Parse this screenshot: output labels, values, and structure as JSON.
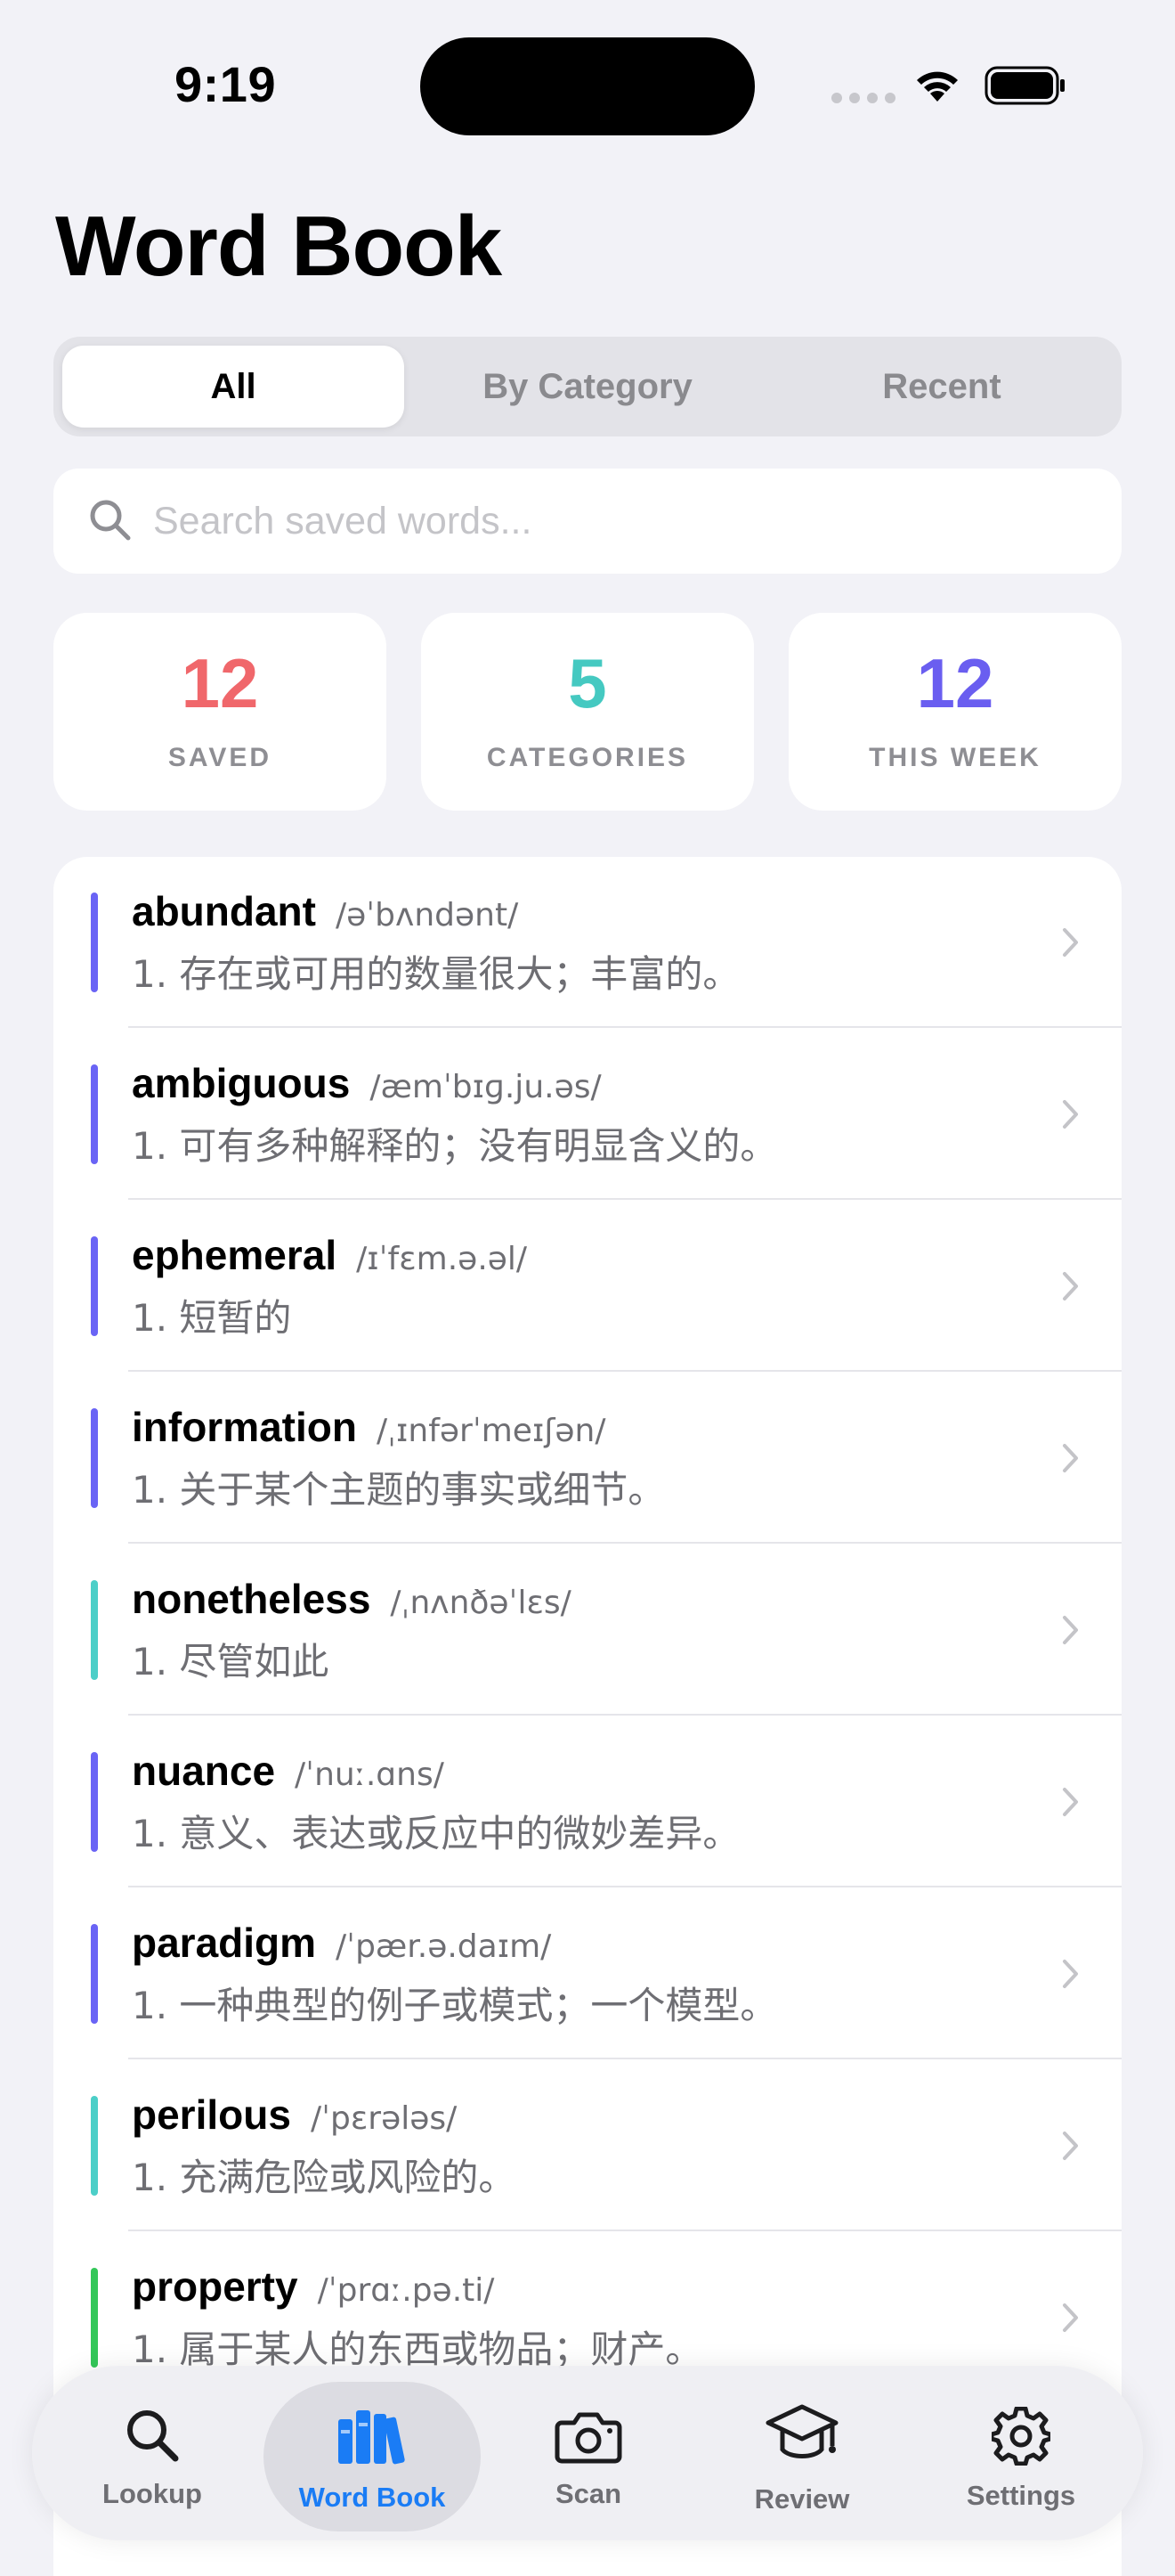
{
  "status_bar": {
    "time": "9:19"
  },
  "header": {
    "title": "Word Book"
  },
  "segments": [
    {
      "label": "All",
      "active": true
    },
    {
      "label": "By Category",
      "active": false
    },
    {
      "label": "Recent",
      "active": false
    }
  ],
  "search": {
    "placeholder": "Search saved words...",
    "value": ""
  },
  "stats": [
    {
      "value": "12",
      "label": "SAVED",
      "color": "#f0676b"
    },
    {
      "value": "5",
      "label": "CATEGORIES",
      "color": "#45c9c1"
    },
    {
      "value": "12",
      "label": "THIS WEEK",
      "color": "#6a5ef0"
    }
  ],
  "words": [
    {
      "word": "abundant",
      "phonetic": "/əˈbʌndənt/",
      "definition": "1. 存在或可用的数量很大；丰富的。",
      "accent": "#6a64f5"
    },
    {
      "word": "ambiguous",
      "phonetic": "/æmˈbɪɡ.ju.əs/",
      "definition": "1. 可有多种解释的；没有明显含义的。",
      "accent": "#6a64f5"
    },
    {
      "word": "ephemeral",
      "phonetic": "/ɪˈfɛm.ə.əl/",
      "definition": "1. 短暂的",
      "accent": "#6a64f5"
    },
    {
      "word": "information",
      "phonetic": "/ˌɪnfərˈmeɪʃən/",
      "definition": "1. 关于某个主题的事实或细节。",
      "accent": "#6a64f5"
    },
    {
      "word": "nonetheless",
      "phonetic": "/ˌnʌnðəˈlɛs/",
      "definition": "1. 尽管如此",
      "accent": "#4ccfc8"
    },
    {
      "word": "nuance",
      "phonetic": "/ˈnuː.ɑns/",
      "definition": "1. 意义、表达或反应中的微妙差异。",
      "accent": "#6a64f5"
    },
    {
      "word": "paradigm",
      "phonetic": "/ˈpær.ə.daɪm/",
      "definition": "1. 一种典型的例子或模式；一个模型。",
      "accent": "#6a64f5"
    },
    {
      "word": "perilous",
      "phonetic": "/ˈpɛrələs/",
      "definition": "1. 充满危险或风险的。",
      "accent": "#4ccfc8"
    },
    {
      "word": "property",
      "phonetic": "/ˈprɑː.pə.ti/",
      "definition": "1. 属于某人的东西或物品；财产。",
      "accent": "#34c759"
    }
  ],
  "tabs": [
    {
      "label": "Lookup",
      "icon": "magnifier-icon",
      "active": false
    },
    {
      "label": "Word Book",
      "icon": "books-icon",
      "active": true
    },
    {
      "label": "Scan",
      "icon": "camera-icon",
      "active": false
    },
    {
      "label": "Review",
      "icon": "graduation-cap-icon",
      "active": false
    },
    {
      "label": "Settings",
      "icon": "gear-icon",
      "active": false
    }
  ]
}
